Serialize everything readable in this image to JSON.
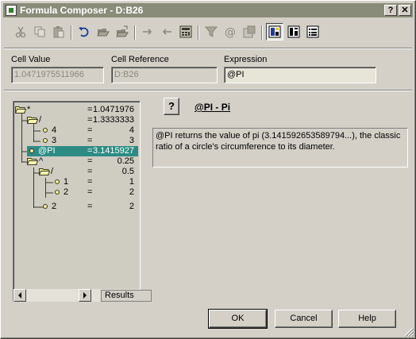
{
  "window": {
    "title": "Formula Composer - D:B26",
    "help_glyph": "?",
    "close_glyph": "✕"
  },
  "toolbar": {
    "tools": [
      "cut-icon",
      "copy-icon",
      "paste-icon",
      "undo-icon",
      "open-icon",
      "save-icon",
      "right-arrow-icon",
      "left-arrow-icon",
      "calculator-icon",
      "filter-icon",
      "at-icon",
      "function-icon",
      "view-tree-icon",
      "view-split-icon",
      "view-list-icon"
    ]
  },
  "fields": {
    "cell_value_label": "Cell Value",
    "cell_value": "1.0471975511966",
    "cell_reference_label": "Cell Reference",
    "cell_reference": "D:B26",
    "expression_label": "Expression",
    "expression": "@PI"
  },
  "tree": {
    "nodes": [
      {
        "label": "*",
        "eq": "=",
        "value": "1.0471976"
      },
      {
        "label": "/",
        "eq": "=",
        "value": "1.3333333"
      },
      {
        "label": "4",
        "eq": "=",
        "value": "4"
      },
      {
        "label": "3",
        "eq": "=",
        "value": "3"
      },
      {
        "label": "@PI",
        "eq": "=",
        "value": "3.1415927"
      },
      {
        "label": "^",
        "eq": "=",
        "value": "0.25"
      },
      {
        "label": "/",
        "eq": "=",
        "value": "0.5"
      },
      {
        "label": "1",
        "eq": "=",
        "value": "1"
      },
      {
        "label": "2",
        "eq": "=",
        "value": "2"
      },
      {
        "label": "2",
        "eq": "=",
        "value": "2"
      }
    ],
    "tab_label": "Results"
  },
  "help": {
    "button_label": "?",
    "title": "@PI - Pi",
    "description": "@PI returns the value of pi (3.141592653589794...), the classic ratio of a circle's circumference to its diameter."
  },
  "buttons": {
    "ok": "OK",
    "cancel": "Cancel",
    "help": "Help"
  },
  "colors": {
    "titlebar": "#8a8c7a",
    "selection": "#2c8c84",
    "window": "#d4d0c8"
  }
}
